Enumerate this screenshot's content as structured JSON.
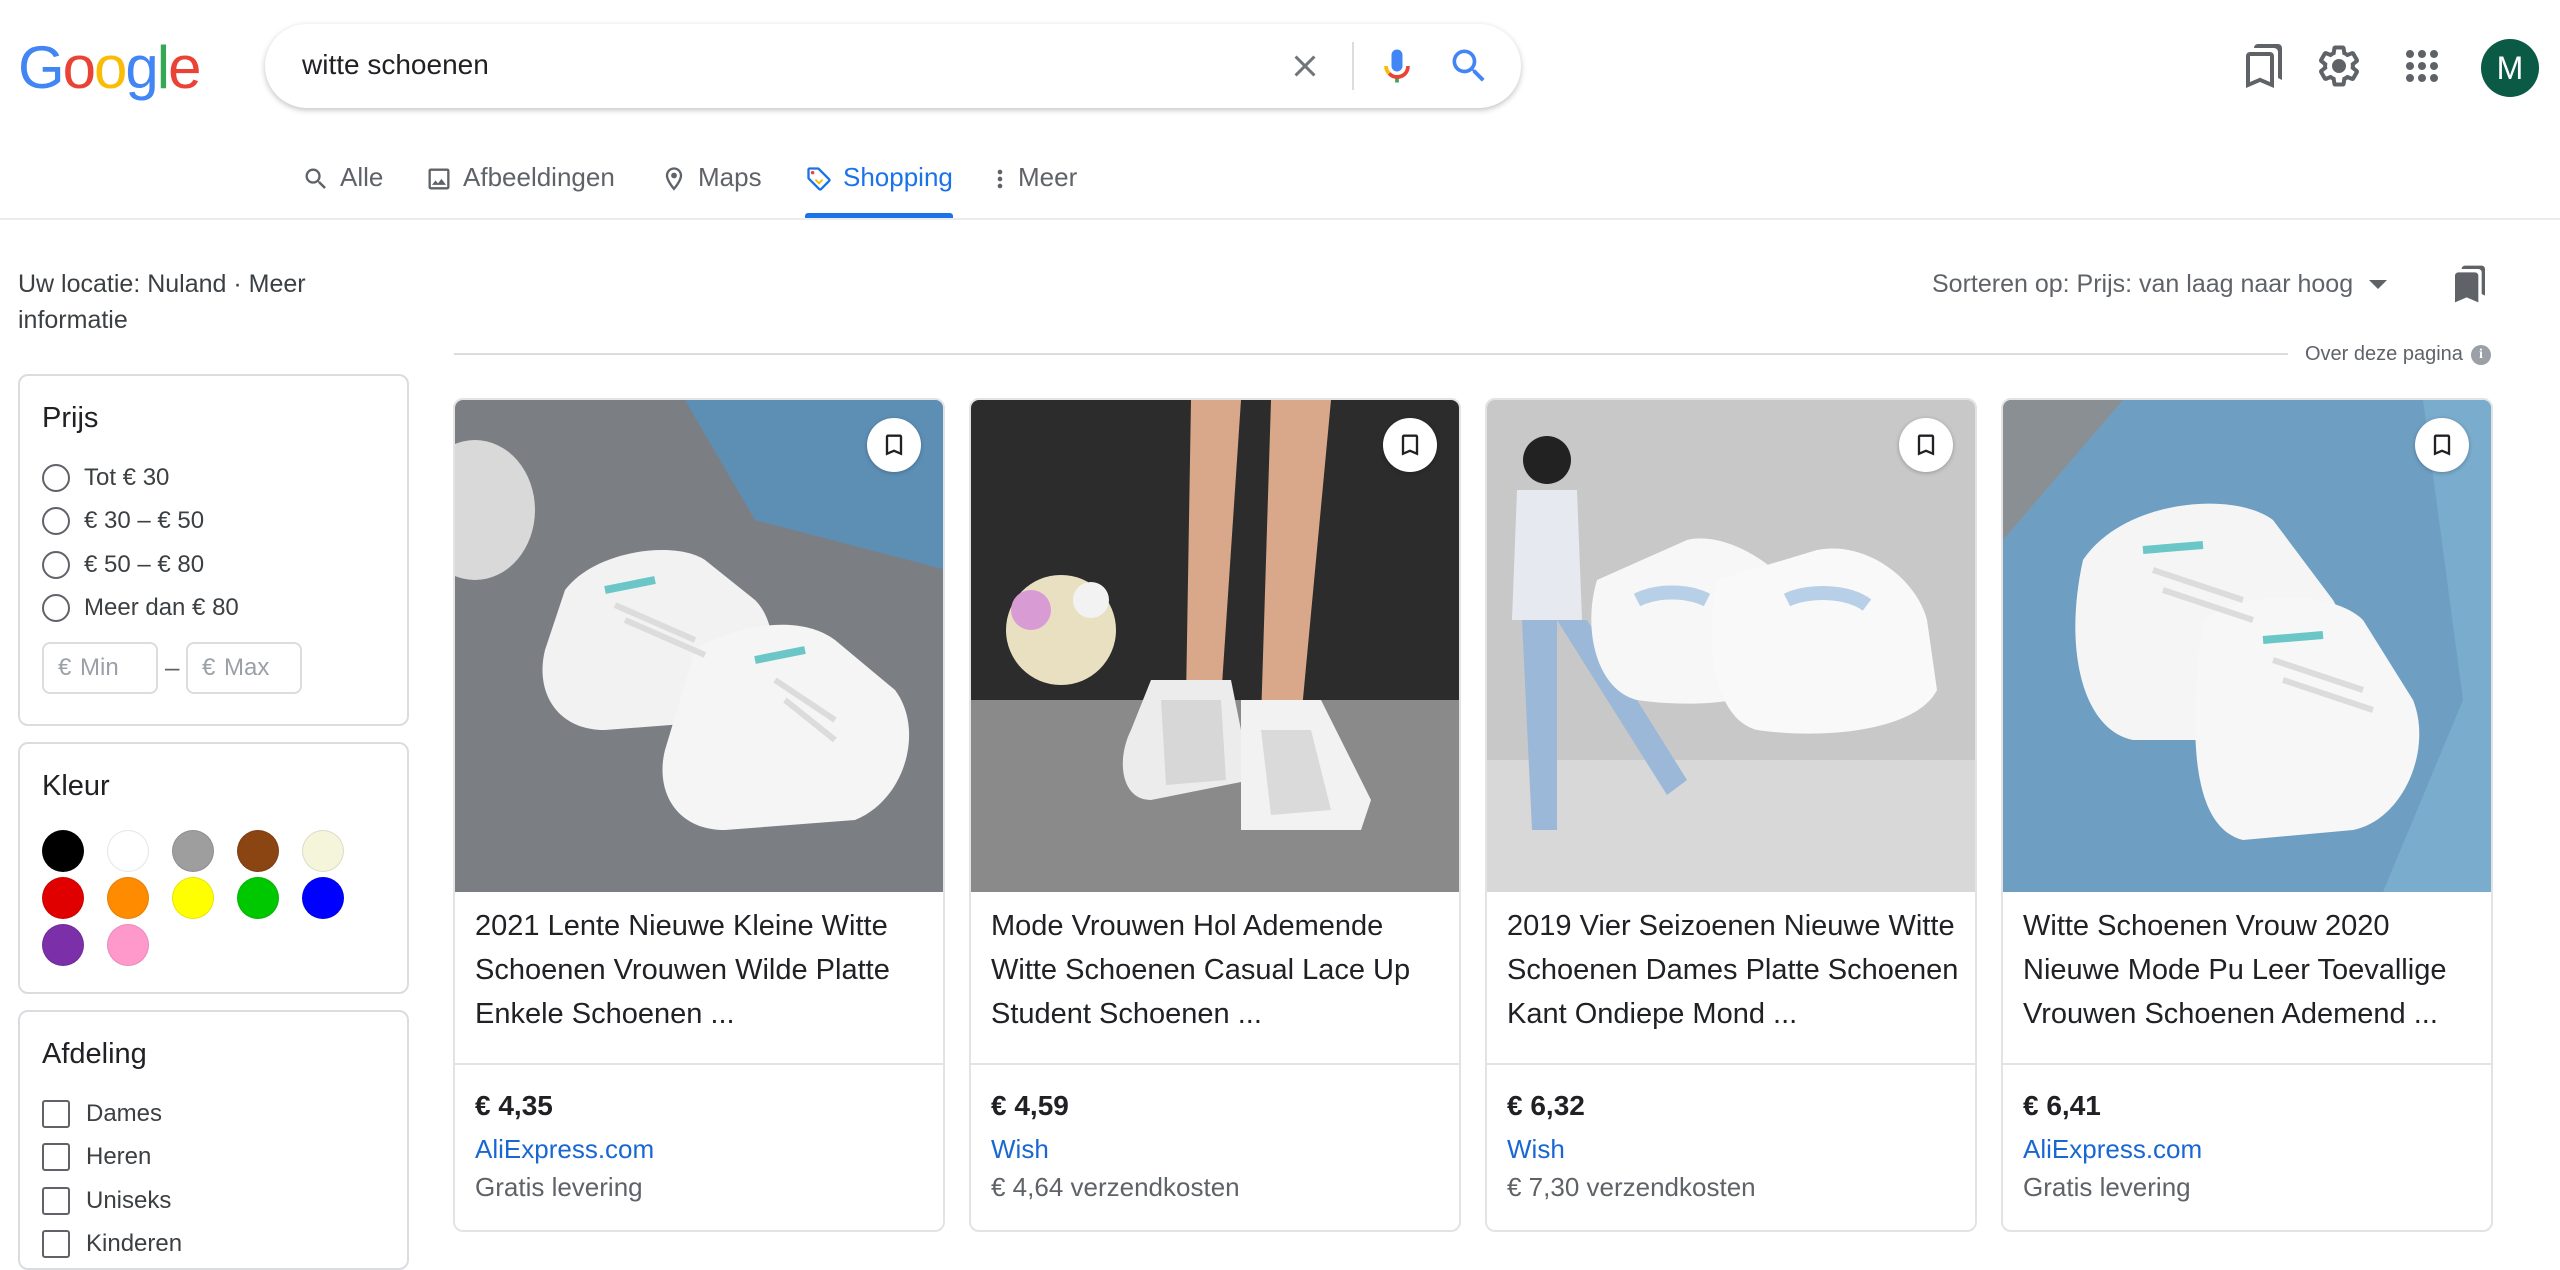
{
  "header": {
    "logo": "Google",
    "search": {
      "query": "witte schoenen"
    },
    "icons": [
      "clear-icon",
      "microphone-icon",
      "search-icon",
      "saved-items-icon",
      "settings-gear-icon",
      "apps-grid-icon"
    ],
    "avatar_initial": "M"
  },
  "tabs": [
    {
      "label": "Alle",
      "icon": "search-icon"
    },
    {
      "label": "Afbeeldingen",
      "icon": "image-icon"
    },
    {
      "label": "Maps",
      "icon": "map-pin-icon"
    },
    {
      "label": "Shopping",
      "icon": "price-tag-icon",
      "active": true
    },
    {
      "label": "Meer",
      "icon": "more-vertical-icon"
    }
  ],
  "location": {
    "text": "Uw locatie: Nuland · ",
    "link": "Meer informatie"
  },
  "filters": {
    "price": {
      "title": "Prijs",
      "options": [
        "Tot € 30",
        "€ 30 – € 50",
        "€ 50 – € 80",
        "Meer dan € 80"
      ],
      "min_prefix": "€",
      "min_placeholder": "Min",
      "max_prefix": "€",
      "max_placeholder": "Max",
      "separator": "–"
    },
    "color": {
      "title": "Kleur",
      "swatches": [
        "#000000",
        "#ffffff",
        "#9e9e9e",
        "#8b4513",
        "#f5f5dc",
        "#e00000",
        "#ff8c00",
        "#ffff00",
        "#00c800",
        "#0000ff",
        "#7b2fa8",
        "#ff99cc"
      ]
    },
    "department": {
      "title": "Afdeling",
      "options": [
        "Dames",
        "Heren",
        "Uniseks",
        "Kinderen"
      ]
    }
  },
  "sort": {
    "label": "Sorteren op: Prijs: van laag naar hoog"
  },
  "about": {
    "label": "Over deze pagina"
  },
  "products": [
    {
      "title": "2021 Lente Nieuwe Kleine Witte Schoenen Vrouwen Wilde Platte Enkele Schoenen ...",
      "price": "€ 4,35",
      "store": "AliExpress.com",
      "shipping": "Gratis levering"
    },
    {
      "title": "Mode Vrouwen Hol Ademende Witte Schoenen Casual Lace Up Student Schoenen ...",
      "price": "€ 4,59",
      "store": "Wish",
      "shipping": "€ 4,64 verzendkosten"
    },
    {
      "title": "2019 Vier Seizoenen Nieuwe Witte Schoenen Dames Platte Schoenen Kant Ondiepe Mond ...",
      "price": "€ 6,32",
      "store": "Wish",
      "shipping": "€ 7,30 verzendkosten"
    },
    {
      "title": "Witte Schoenen Vrouw 2020 Nieuwe Mode Pu Leer Toevallige Vrouwen Schoenen Ademend ...",
      "price": "€ 6,41",
      "store": "AliExpress.com",
      "shipping": "Gratis levering"
    }
  ]
}
